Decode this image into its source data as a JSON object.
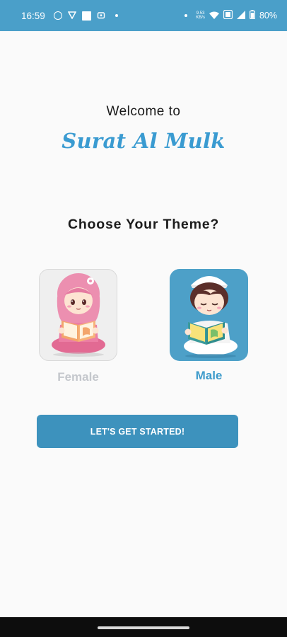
{
  "status_bar": {
    "time": "16:59",
    "net_speed_value": "9.53",
    "net_speed_unit": "KB/s",
    "battery": "80%",
    "icons": [
      "whatsapp-icon",
      "vpn-shield-icon",
      "notification-square-icon",
      "app-notification-icon",
      "dot-icon",
      "dot-icon",
      "wifi-icon",
      "volte-icon",
      "signal-icon",
      "battery-icon"
    ],
    "color": "#4a9fc9"
  },
  "welcome": {
    "line1": "Welcome to",
    "title": "Surat Al Mulk"
  },
  "theme_picker": {
    "heading": "Choose Your Theme?",
    "options": [
      {
        "label": "Female",
        "selected": false
      },
      {
        "label": "Male",
        "selected": true
      }
    ]
  },
  "cta": {
    "label": "LET'S GET STARTED!"
  },
  "colors": {
    "accent": "#3a9bd1",
    "selected_card": "#4da0c8",
    "button": "#3d92bd",
    "unselected_label": "#c4c7cc"
  }
}
